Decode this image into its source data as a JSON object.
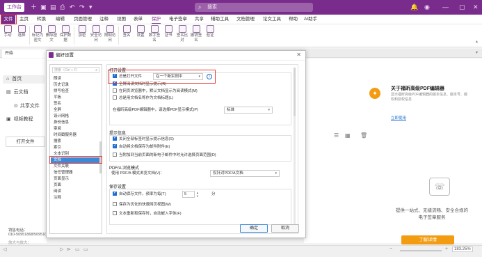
{
  "titlebar": {
    "app_tab": "工作台",
    "search_placeholder": "搜索"
  },
  "menu": {
    "items": [
      "文件",
      "主页",
      "转换",
      "编辑",
      "页面管理",
      "注释",
      "视图",
      "表单",
      "保护",
      "电子签章",
      "共享",
      "辅助工具",
      "文档管理",
      "论文工具",
      "帮助",
      "AI助手"
    ],
    "active": "保护"
  },
  "ribbon": {
    "buttons": [
      "手动",
      "选择",
      "标记为密文",
      "删除密文",
      "保护数据",
      "加密",
      "安全访问",
      "限制访问",
      "签名",
      "设置",
      "数字签名",
      "证书",
      "签名比对",
      "撤销签名",
      "验证"
    ]
  },
  "doc_tab": "开始",
  "leftpane": {
    "home": "首页",
    "cloud": "云文档",
    "share": "共享文件",
    "video": "视频教程",
    "open_file": "打开文件",
    "sales_label": "销售电话：",
    "sales_phone": "010-50951868/50951000",
    "bottom_text": "放大与放大："
  },
  "dialog": {
    "title": "偏好设置",
    "search_placeholder": "搜索（Ctrl + F）",
    "categories": [
      "朗读",
      "历史记录",
      "拼写检查",
      "平板",
      "签名",
      "全屏",
      "设计网格",
      "身份信息",
      "审阅",
      "时间戳服务器",
      "搜索",
      "索引",
      "文本识别",
      "文档",
      "文件关联",
      "信任管理器",
      "页面显示",
      "页面",
      "阅读",
      "注释"
    ],
    "selected_category": "文档",
    "sections": {
      "open": {
        "title": "打开设置",
        "open_always_label": "总是打开文件",
        "open_mode_value": "在一个新实例中",
        "restore_state": "全屏阅读文档时显示提示(R)",
        "open_reading_mode": "在网页浏览器中，默认文档显示为阅读模式(M)",
        "always_show_filename": "总是用文档名称作为文档标题(L)",
        "page_layout_label": "在福昕高级PDF编辑器中，请选择PDF显示模式(P)",
        "page_layout_value": "标准"
      },
      "prompt": {
        "title": "提示信息",
        "close_prompt": "关闭全部标签时显示提示信息(S)",
        "auto_save_prompt": "自动将文档保存为邮件附件(E)",
        "email_prompt": "当附加到当前页面的新电子邮件中时允许选择页面范围(D)"
      },
      "pdfa": {
        "title": "PDF/A 浏览模式",
        "view_label": "使用 PDF/A 模式浏览文档(V)：",
        "view_value": "仅针对PDF/A文档"
      },
      "save": {
        "title": "保存设置",
        "auto_save_label": "自动保存文件，频率为每(T)",
        "auto_save_value": "5",
        "auto_save_unit": "分",
        "optimize_fast_web": "保存为优化的快速网页视图(W)",
        "embed_fonts": "文本重新和保存时，自动嵌入字体(F)"
      }
    },
    "ok": "确定",
    "cancel": "取消"
  },
  "rightpanel": {
    "promo_title": "关于福昕高级PDF编辑器",
    "promo_desc": "显示福昕高级PDF编辑器的版本信息、版本号、版权和授权信息",
    "promo_link": "立即使用",
    "service_text": "提供一站式、无缝流畅、安全合规的电子签章服务",
    "service_button": "了解详情"
  },
  "statusbar": {
    "zoom": "183.25%"
  }
}
